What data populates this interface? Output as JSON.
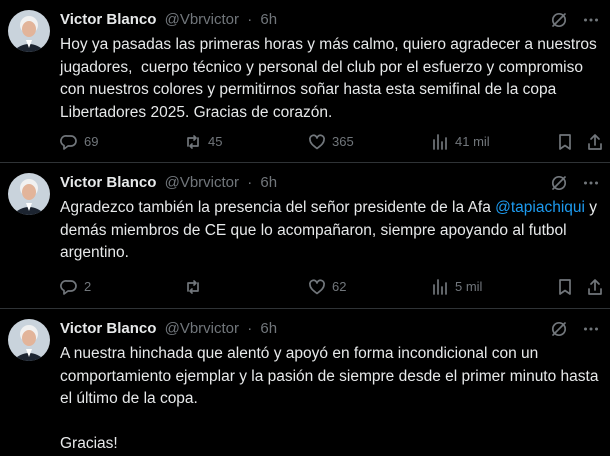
{
  "tweets": [
    {
      "name": "Victor Blanco",
      "handle": "@Vbrvictor",
      "sep": "·",
      "time": "6h",
      "text": "Hoy ya pasadas las primeras horas y más calmo, quiero agradecer a nuestros jugadores,  cuerpo técnico y personal del club por el esfuerzo y compromiso con nuestros colores y permitirnos soñar hasta esta semifinal de la copa Libertadores 2025. Gracias de corazón.",
      "replies": "69",
      "reposts": "45",
      "likes": "365",
      "views": "41 mil"
    },
    {
      "name": "Victor Blanco",
      "handle": "@Vbrvictor",
      "sep": "·",
      "time": "6h",
      "text_before": "Agradezco también la presencia del señor presidente de la Afa ",
      "mention": "@tapiachiqui",
      "text_after": " y demás miembros de CE que lo acompañaron, siempre apoyando al futbol argentino.",
      "replies": "2",
      "reposts": "",
      "likes": "62",
      "views": "5 mil"
    },
    {
      "name": "Victor Blanco",
      "handle": "@Vbrvictor",
      "sep": "·",
      "time": "6h",
      "text": "A nuestra hinchada que alentó y apoyó en forma incondicional con un comportamiento ejemplar y la pasión de siempre desde el primer minuto hasta el último de la copa.\n\nGracias!"
    }
  ],
  "colors": {
    "background": "#000000",
    "text": "#e7e9ea",
    "muted": "#71767b",
    "link": "#1d9bf0",
    "divider": "#2f3336"
  },
  "icons": [
    "grok-icon",
    "more-icon",
    "reply-icon",
    "repost-icon",
    "like-icon",
    "views-icon",
    "bookmark-icon",
    "share-icon"
  ]
}
